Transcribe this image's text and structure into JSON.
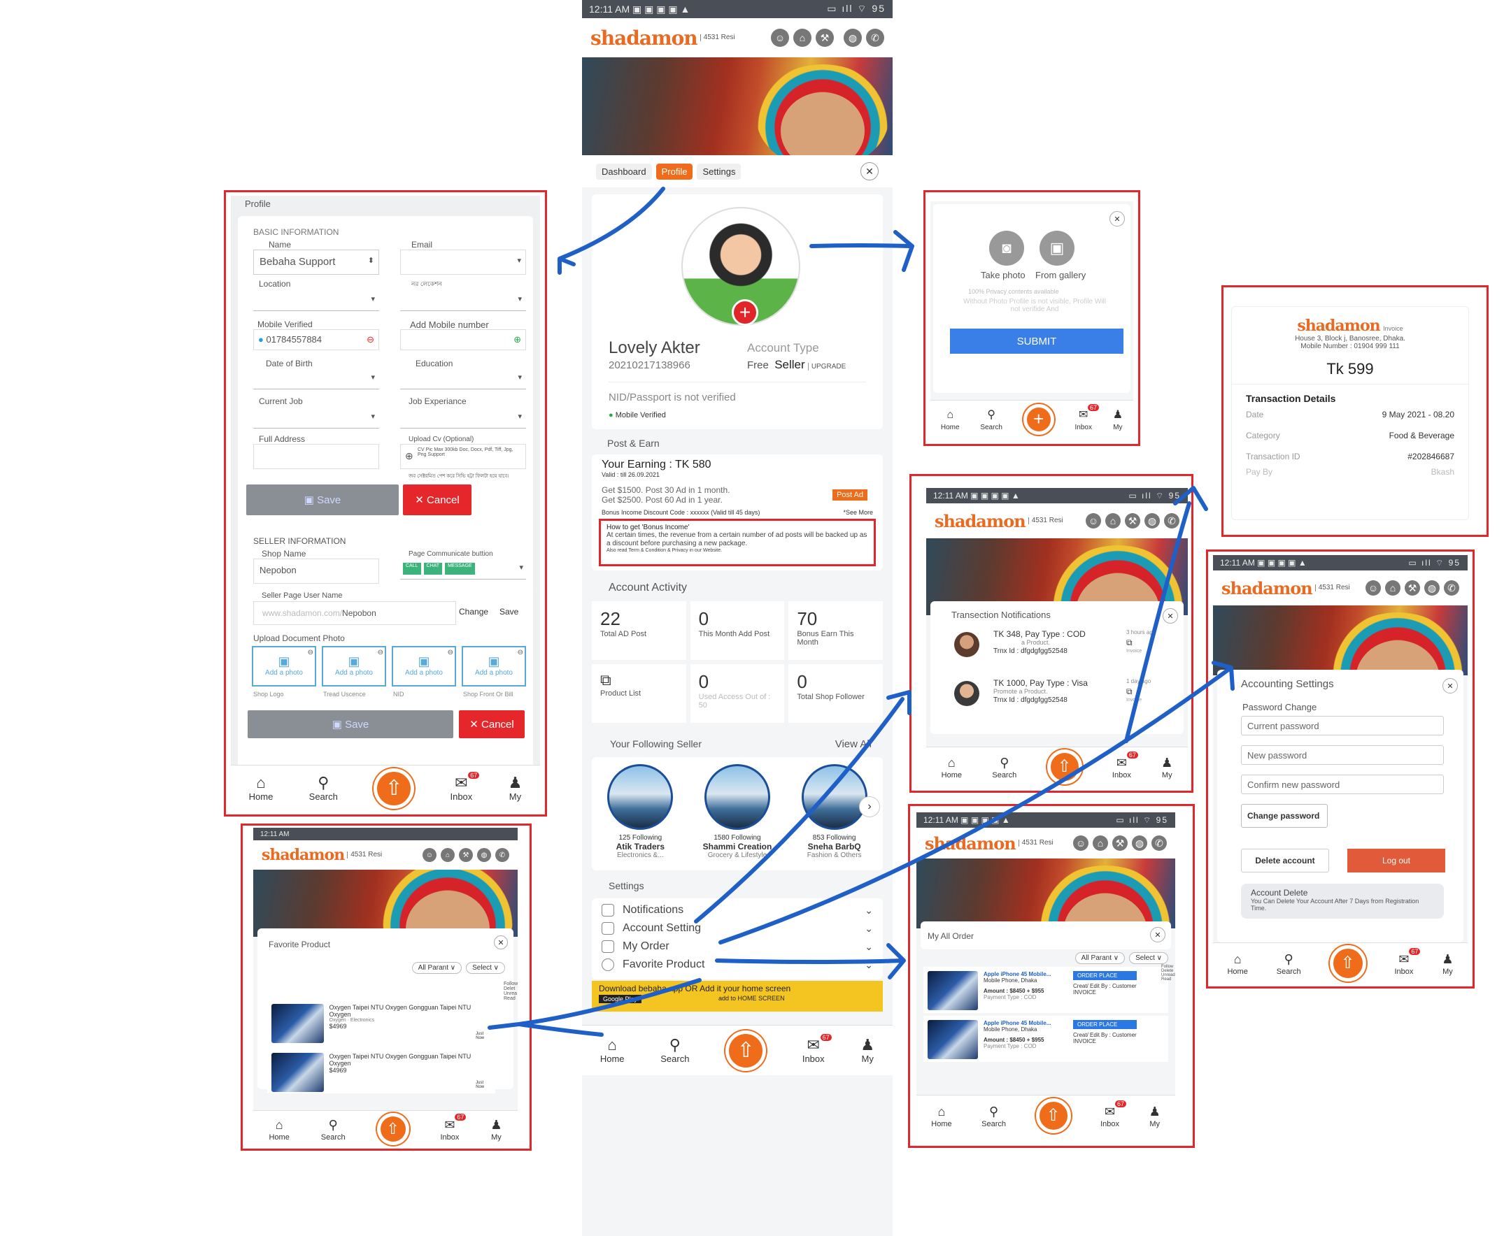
{
  "statusbar": {
    "time": "12:11 AM",
    "icons": "▣ ▣ ▣ ▣ ▲",
    "right": "▭ ıll ⌔ 95"
  },
  "app": {
    "logo": "shadamon",
    "logo_tag": "4531 Resi"
  },
  "header_icons": [
    "person-icon",
    "gift-icon",
    "hammer-icon",
    "globe-icon",
    "phone-icon"
  ],
  "nav": {
    "home": "Home",
    "search": "Search",
    "inbox": "Inbox",
    "inbox_badge": "67",
    "my": "My"
  },
  "center": {
    "tabs": [
      "Dashboard",
      "Profile",
      "Settings"
    ],
    "profile": {
      "name": "Lovely Akter",
      "id": "20210217138966",
      "account_type_label": "Account Type",
      "account_free": "Free",
      "account_seller": "Seller",
      "upgrade": "UPGRADE",
      "nid": "NID/Passport is not verified",
      "mobile_verified": "Mobile Verified"
    },
    "post_earn": {
      "heading": "Post & Earn",
      "earning": "Your Earning : TK 580",
      "valid": "Valid : till 26.09.2021",
      "line1": "Get $1500. Post 30 Ad in 1 month.",
      "line2": "Get $2500. Post 60 Ad in 1 year.",
      "post_ad": "Post Ad",
      "discount": "Bonus Income Discount Code : xxxxxx (Valid till 45 days)",
      "see_more": "*See More",
      "bonus_title": "How to get 'Bonus Income'",
      "bonus_text": "At certain times, the revenue from a certain number of ad posts will be backed up as a discount before purchasing a new package.",
      "bonus_terms": "Also read Term & Condition & Privacy in our Website."
    },
    "activity": {
      "heading": "Account Activity",
      "stats": [
        {
          "n": "22",
          "t": "Total AD Post"
        },
        {
          "n": "0",
          "t": "This Month Add Post"
        },
        {
          "n": "70",
          "t": "Bonus Earn This Month"
        },
        {
          "n": "",
          "t": "Product List"
        },
        {
          "n": "0",
          "t": "Used Access Out of : 50"
        },
        {
          "n": "0",
          "t": "Total Shop Follower"
        }
      ]
    },
    "following": {
      "heading": "Your Following Seller",
      "view_all": "View All",
      "sellers": [
        {
          "count": "125 Following",
          "name": "Atik Traders",
          "cat": "Electronics &..."
        },
        {
          "count": "1580 Following",
          "name": "Shammi Creation",
          "cat": "Grocery & Lifestyle"
        },
        {
          "count": "853 Following",
          "name": "Sneha BarbQ",
          "cat": "Fashion & Others"
        }
      ]
    },
    "settings": {
      "heading": "Settings",
      "items": [
        "Notifications",
        "Account Setting",
        "My Order",
        "Favorite Product"
      ]
    },
    "download": {
      "text": "Download bebaha app  OR Add it your home screen",
      "gplay": "Google Play",
      "home": "add to HOME SCREEN"
    }
  },
  "profile_form": {
    "title": "Profile",
    "basic": "BASIC INFORMATION",
    "name_label": "Name",
    "name_value": "Bebaha Support",
    "email_label": "Email",
    "location_label": "Location",
    "bangla_label": "নর লেকেশন",
    "mobile_label": "Mobile Verified",
    "mobile_value": "01784557884",
    "add_mobile": "Add Mobile number",
    "dob": "Date of Birth",
    "education": "Education",
    "job": "Current Job",
    "experience": "Job Experiance",
    "address": "Full Address",
    "cv": "Upload Cv (Optional)",
    "cv_note": "CV Pic Max 300kb Doc, Docx, Pdf, Tiff, Jpg, Png Support",
    "cv_bangla": "জব সেক্টরমিত পেশ করে সিভি হট্টা ফিলটা হয়ে যাবে।",
    "save": "Save",
    "cancel": "Cancel",
    "seller": "SELLER INFORMATION",
    "shop_label": "Shop Name",
    "shop_value": "Nepobon",
    "comm_label": "Page Communicate buttion",
    "comm_btns": [
      "CALL",
      "CHAT",
      "MESSAGE"
    ],
    "page_user_label": "Seller Page User Name",
    "page_url": "www.shadamon.com/",
    "page_slug": "Nepobon",
    "change": "Change",
    "save_small": "Save",
    "upload": "Upload Document Photo",
    "add_photo": "Add a photo",
    "docs": [
      "Shop Logo",
      "Tread Uscence",
      "NID",
      "Shop Front Or Bill"
    ]
  },
  "photo_dialog": {
    "take": "Take photo",
    "gallery": "From gallery",
    "note1": "100% Privacy contents available",
    "note2": "Without Photo Profile is not visible, Profile Will not verifide And",
    "submit": "SUBMIT"
  },
  "invoice": {
    "logo": "shadamon",
    "tag": "Invoice",
    "address": "House 3, Block j, Banosree, Dhaka.",
    "mobile": "Mobile Number : 01904 999 111",
    "amount": "Tk 599",
    "details": "Transaction Details",
    "rows": [
      {
        "k": "Date",
        "v": "9 May 2021 - 08.20"
      },
      {
        "k": "Category",
        "v": "Food & Beverage"
      },
      {
        "k": "Transaction ID",
        "v": "#202846687"
      },
      {
        "k": "Pay By",
        "v": "Bkash"
      }
    ]
  },
  "notifications": {
    "title": "Transection Notifications",
    "items": [
      {
        "title": "TK 348, Pay Type : COD",
        "sub": "a Product.",
        "trx": "Trnx Id : dfgdgfgg52548",
        "time": "3 hours ago",
        "invoice": "Invoice"
      },
      {
        "title": "TK 1000, Pay Type : Visa",
        "sub": "Promote a Product.",
        "trx": "Trnx Id : dfgdgfgg52548",
        "time": "1 day ago",
        "invoice": "Invoice"
      }
    ]
  },
  "accounting": {
    "title": "Accounting Settings",
    "pw_change": "Password Change",
    "current": "Current password",
    "new": "New password",
    "confirm": "Confirm new password",
    "change_btn": "Change password",
    "delete": "Delete account",
    "logout": "Log out",
    "del_title": "Account Delete",
    "del_text": "You Can Delete Your Account After 7 Days from Registration Time."
  },
  "favorite": {
    "title": "Favorite Product",
    "all_parent": "All Parant ∨",
    "select": "Select ∨",
    "side": "Follow Delet Unrea Read",
    "items": [
      {
        "name": "Oxygen Taipei NTU Oxygen Gongguan Taipei NTU Oxygen",
        "cat": "Oxygen · Electronics",
        "price": "$4969",
        "time": "Just Now"
      },
      {
        "name": "Oxygen Taipei NTU Oxygen Gongguan Taipei NTU Oxygen",
        "cat": "",
        "price": "$4969",
        "time": "Just Now"
      }
    ]
  },
  "orders": {
    "title": "My All Order",
    "all_parent": "All Parant ∨",
    "select": "Select ∨",
    "side": "Follow Delete Unread Read",
    "items": [
      {
        "name": "Apple iPhone 45 Mobile...",
        "cat": "Mobile Phone, Dhaka",
        "amount": "Amount : $8450 + $955",
        "pay": "Payment Type : COD",
        "btn": "ORDER PLACE",
        "edit": "Creat/ Edit By : Customer",
        "invoice": "INVOICE"
      },
      {
        "name": "Apple iPhone 45 Mobile...",
        "cat": "Mobile Phone, Dhaka",
        "amount": "Amount : $8450 + $955",
        "pay": "Payment Type : COD",
        "btn": "ORDER PLACE",
        "edit": "Creat/ Edit By : Customer",
        "invoice": "INVOICE"
      }
    ]
  }
}
